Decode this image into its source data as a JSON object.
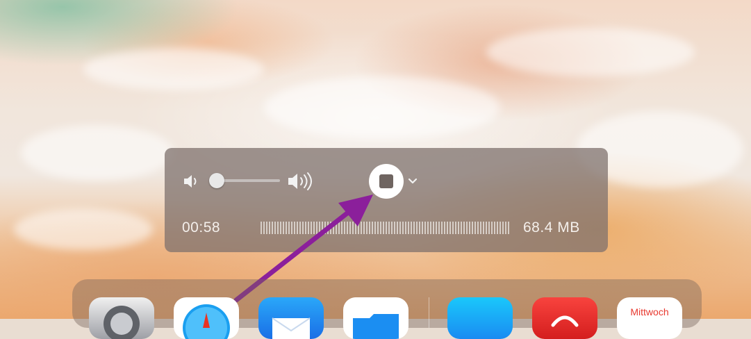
{
  "recording_hud": {
    "elapsed_time": "00:58",
    "file_size": "68.4 MB",
    "volume_level": 0.0,
    "icons": {
      "volume_low": "speaker-low-icon",
      "volume_high": "speaker-high-icon",
      "stop": "stop-icon",
      "options": "chevron-down-icon"
    }
  },
  "annotation": {
    "icon": "arrow-icon",
    "color": "#8b1f9b"
  },
  "dock": {
    "apps": [
      {
        "name": "settings-app-icon"
      },
      {
        "name": "safari-app-icon"
      },
      {
        "name": "mail-app-icon"
      },
      {
        "name": "files-app-icon"
      },
      {
        "name": "app-store-app-icon"
      },
      {
        "name": "red-app-icon"
      },
      {
        "name": "calendar-app-icon",
        "label": "Mittwoch"
      }
    ]
  }
}
